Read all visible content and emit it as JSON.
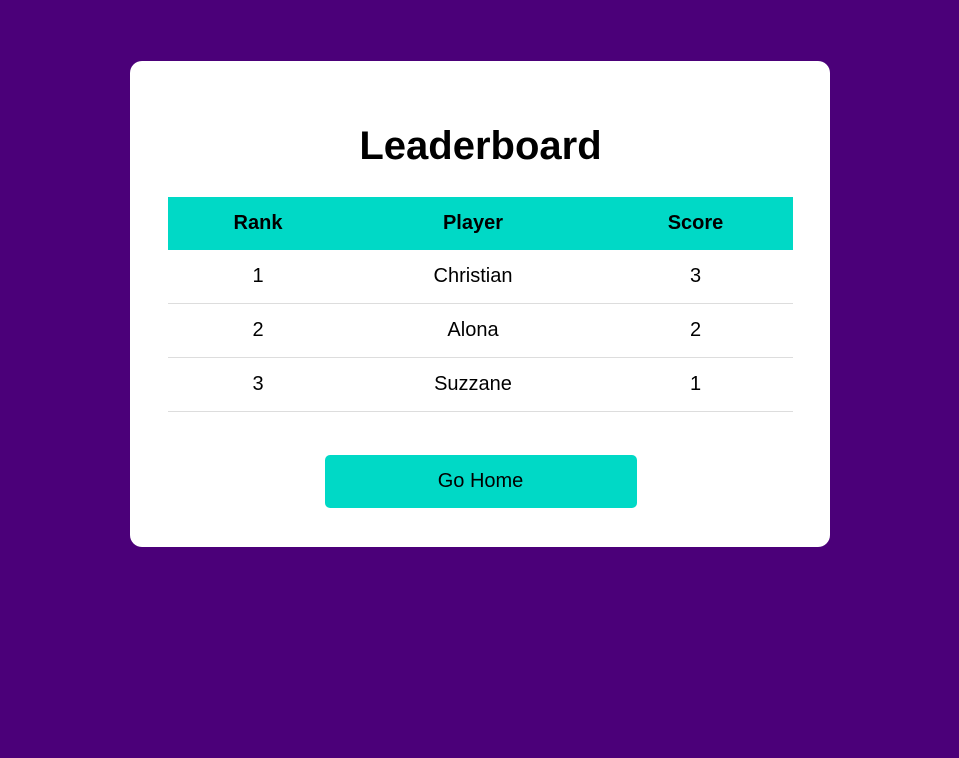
{
  "page": {
    "title": "Leaderboard"
  },
  "table": {
    "headers": {
      "rank": "Rank",
      "player": "Player",
      "score": "Score"
    },
    "rows": [
      {
        "rank": "1",
        "player": "Christian",
        "score": "3"
      },
      {
        "rank": "2",
        "player": "Alona",
        "score": "2"
      },
      {
        "rank": "3",
        "player": "Suzzane",
        "score": "1"
      }
    ]
  },
  "actions": {
    "home_label": "Go Home"
  },
  "colors": {
    "background": "#4b0079",
    "accent": "#00d9c6",
    "card": "#ffffff"
  }
}
